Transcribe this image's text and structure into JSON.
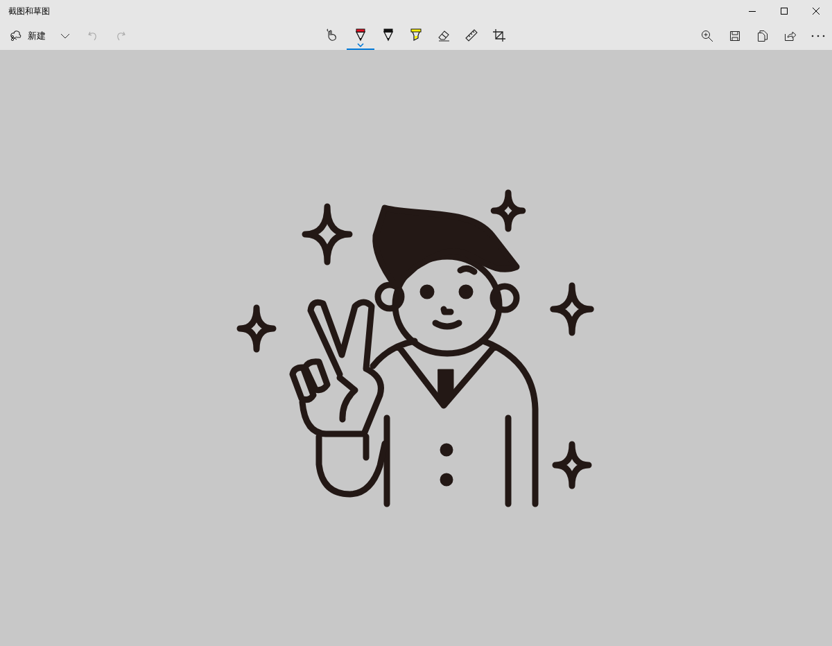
{
  "window": {
    "title": "截图和草图"
  },
  "toolbar": {
    "new_button": {
      "label": "新建"
    },
    "history": [
      {
        "kind": "undo",
        "disabled": true
      },
      {
        "kind": "redo",
        "disabled": true
      }
    ],
    "tools": [
      {
        "kind": "touch",
        "selected": false
      },
      {
        "kind": "pen",
        "color": "#e81123",
        "selected": true
      },
      {
        "kind": "pen",
        "color": "#111111",
        "selected": false
      },
      {
        "kind": "highlighter",
        "color": "#fff100",
        "selected": false
      },
      {
        "kind": "eraser",
        "selected": false
      },
      {
        "kind": "ruler",
        "selected": false
      },
      {
        "kind": "crop",
        "selected": false
      }
    ],
    "actions": [
      {
        "kind": "zoom"
      },
      {
        "kind": "save"
      },
      {
        "kind": "copy"
      },
      {
        "kind": "share"
      },
      {
        "kind": "more"
      }
    ]
  }
}
